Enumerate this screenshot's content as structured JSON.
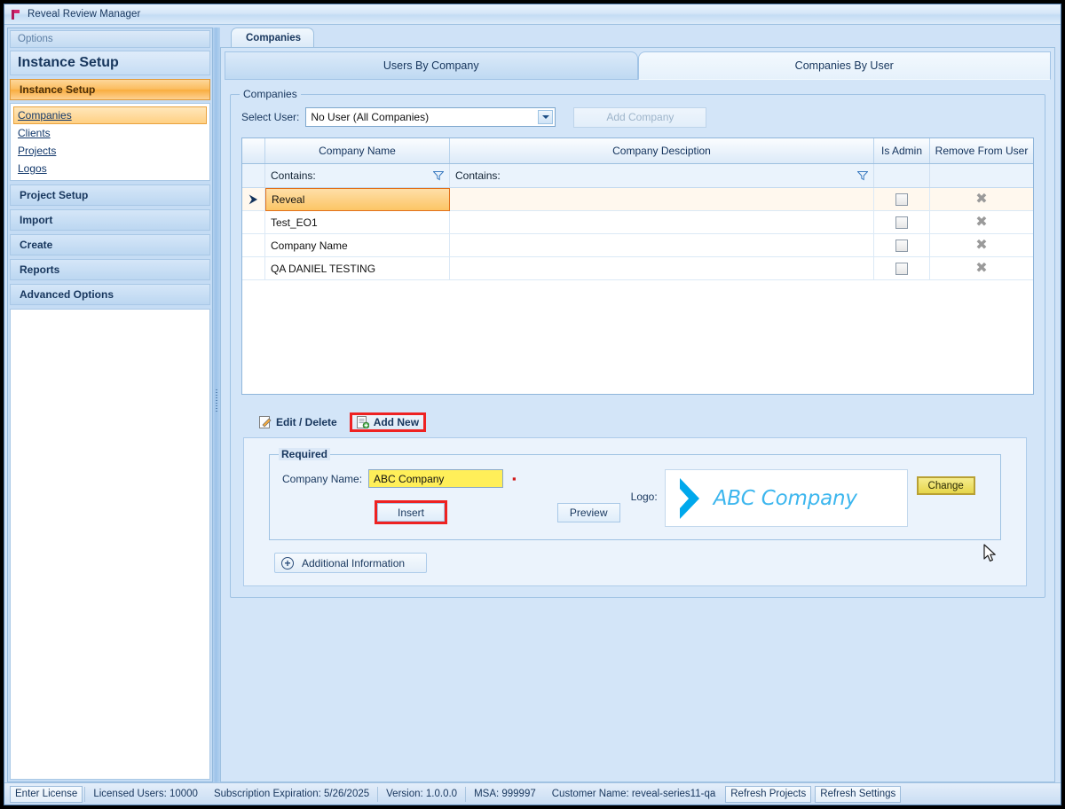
{
  "window": {
    "title": "Reveal Review Manager",
    "app_icon": "reveal-logo-icon"
  },
  "sidebar": {
    "options_label": "Options",
    "header_title": "Instance Setup",
    "groups": [
      {
        "label": "Instance Setup",
        "active": true
      },
      {
        "label": "Project Setup",
        "active": false
      },
      {
        "label": "Import",
        "active": false
      },
      {
        "label": "Create",
        "active": false
      },
      {
        "label": "Reports",
        "active": false
      },
      {
        "label": "Advanced Options",
        "active": false
      }
    ],
    "subitems": [
      {
        "label": "Companies",
        "selected": true
      },
      {
        "label": "Clients",
        "selected": false
      },
      {
        "label": "Projects",
        "selected": false
      },
      {
        "label": "Logos",
        "selected": false
      }
    ]
  },
  "outer_tab": {
    "label": "Companies"
  },
  "inner_tabs": [
    {
      "label": "Users By Company",
      "active": false
    },
    {
      "label": "Companies By User",
      "active": true
    }
  ],
  "companies_group": {
    "legend": "Companies",
    "select_user_label": "Select User:",
    "select_user_value": "No User (All Companies)",
    "add_company_label": "Add Company",
    "add_company_disabled": true
  },
  "grid": {
    "columns": [
      "",
      "Company Name",
      "Company Desciption",
      "Is Admin",
      "Remove From User"
    ],
    "filter_row": {
      "name_placeholder": "Contains:",
      "desc_placeholder": "Contains:"
    },
    "rows": [
      {
        "indicator": "⮞",
        "name": "Reveal",
        "description": "",
        "is_admin": false,
        "remove_icon": "remove-x-icon",
        "selected": true
      },
      {
        "indicator": "",
        "name": "Test_EO1",
        "description": "",
        "is_admin": false,
        "remove_icon": "remove-x-icon",
        "selected": false
      },
      {
        "indicator": "",
        "name": "Company Name",
        "description": "",
        "is_admin": false,
        "remove_icon": "remove-x-icon",
        "selected": false
      },
      {
        "indicator": "",
        "name": "QA DANIEL TESTING",
        "description": "",
        "is_admin": false,
        "remove_icon": "remove-x-icon",
        "selected": false
      }
    ]
  },
  "crud_bar": {
    "edit_delete_label": "Edit / Delete",
    "add_new_label": "Add New"
  },
  "edit_form": {
    "required_legend": "Required",
    "company_name_label": "Company Name:",
    "company_name_value": "ABC Company",
    "required_marker": "▪",
    "insert_label": "Insert",
    "preview_label": "Preview",
    "logo_label": "Logo:",
    "logo_text": "ABC Company",
    "change_label": "Change",
    "additional_info_label": "Additional Information",
    "additional_info_expander": "plus-icon"
  },
  "status_bar": {
    "enter_license_label": "Enter License",
    "licensed_users": "Licensed Users: 10000",
    "subscription_expiration": "Subscription Expiration: 5/26/2025",
    "version": "Version: 1.0.0.0",
    "msa": "MSA: 999997",
    "customer_name": "Customer Name: reveal-series11-qa",
    "refresh_projects_label": "Refresh Projects",
    "refresh_settings_label": "Refresh Settings"
  },
  "colors": {
    "accent_orange": "#f9ad3e",
    "highlight_red": "#ee2222",
    "logo_blue": "#3cb6ee",
    "required_yellow": "#ffef59",
    "change_yellow": "#e6d64a",
    "title_text": "#17365d"
  }
}
